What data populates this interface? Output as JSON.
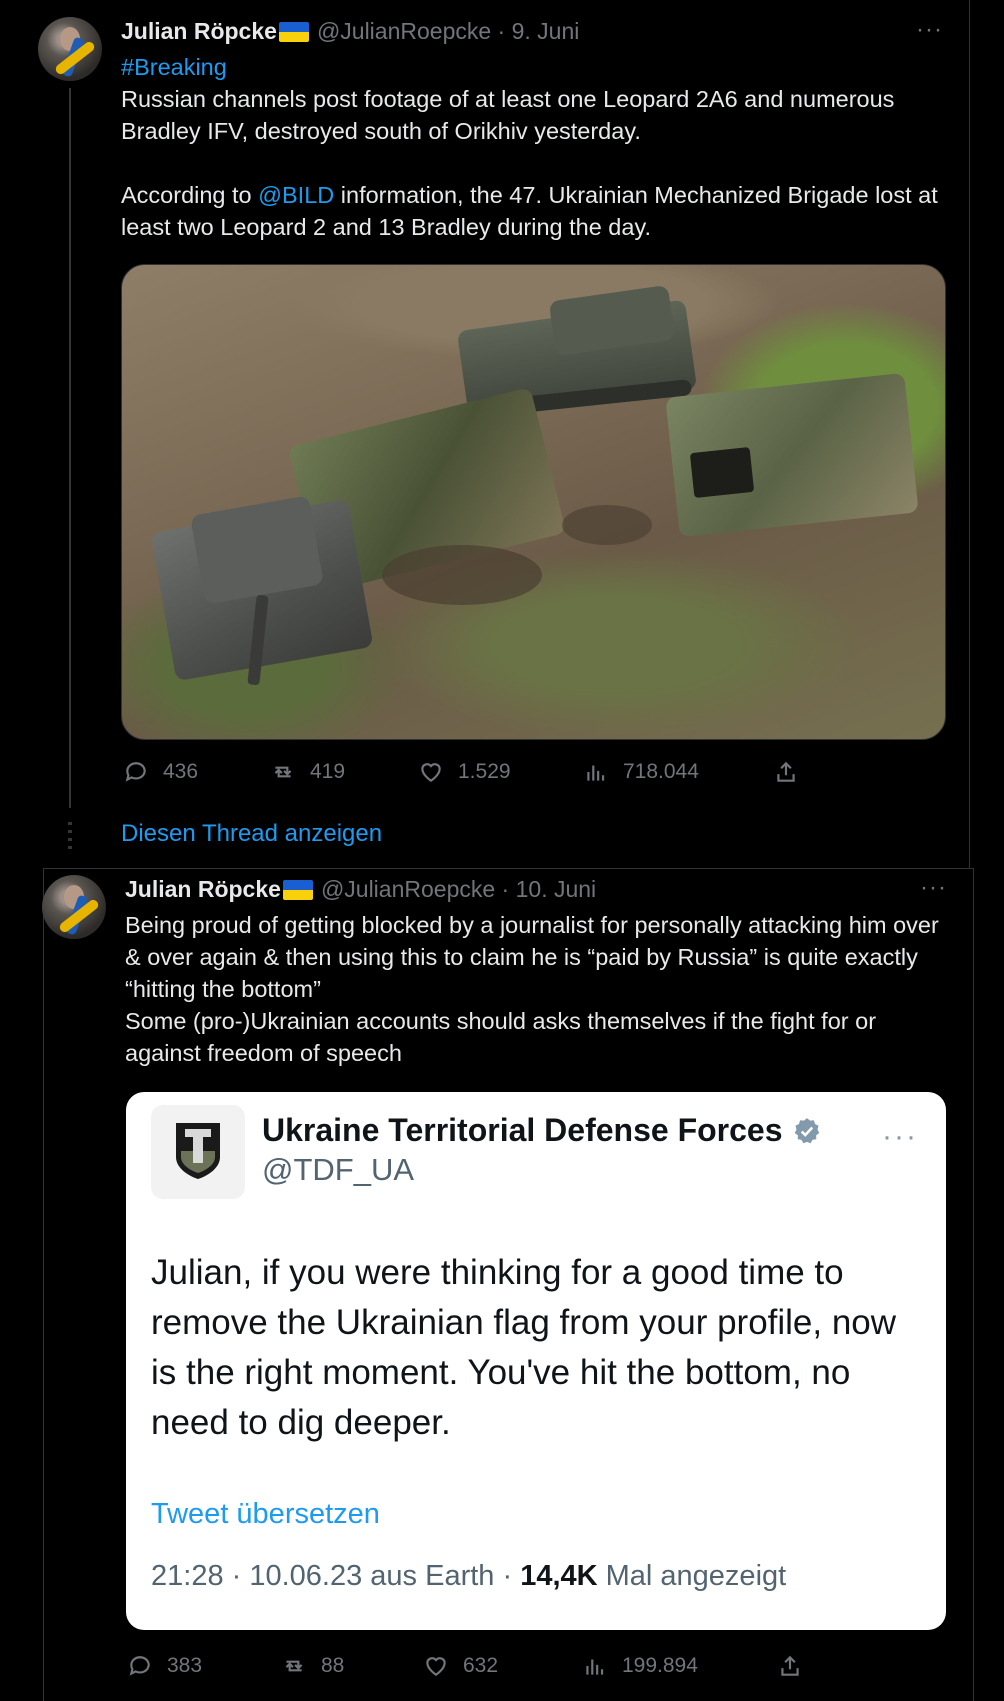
{
  "tweet1": {
    "author_name": "Julian Röpcke",
    "handle": "@JulianRoepcke",
    "date": "9. Juni",
    "more": "···",
    "hashtag": "#Breaking",
    "line1": "Russian channels post footage of at least one Leopard 2A6 and numerous Bradley IFV, destroyed south of Orikhiv yesterday.",
    "line2_prefix": "According to ",
    "mention": "@BILD",
    "line2_suffix": " information, the 47. Ukrainian Mechanized Brigade lost at least two Leopard 2 and 13 Bradley during the day.",
    "replies": "436",
    "retweets": "419",
    "likes": "1.529",
    "views": "718.044"
  },
  "show_thread": "Diesen Thread anzeigen",
  "tweet2": {
    "author_name": "Julian Röpcke",
    "handle": "@JulianRoepcke",
    "date": "10. Juni",
    "more": "···",
    "body_l1": "Being proud of getting blocked by a journalist for personally attacking him over & over again & then using this to claim he is “paid by Russia” is quite exactly “hitting the bottom”",
    "body_l2": "Some (pro-)Ukrainian accounts should asks themselves if the fight for or against freedom of speech",
    "replies": "383",
    "retweets": "88",
    "likes": "632",
    "views": "199.894"
  },
  "quote": {
    "name": "Ukraine Territorial Defense Forces",
    "handle": "@TDF_UA",
    "more": "···",
    "text": "Julian, if you were thinking for a good time to remove the Ukrainian flag from your profile, now is the right moment. You've hit the bottom, no need to dig deeper.",
    "translate": "Tweet übersetzen",
    "meta_prefix": "21:28 · 10.06.23 aus Earth · ",
    "views_bold": "14,4K",
    "views_suffix": " Mal angezeigt"
  },
  "colors": {
    "link": "#1d9bf0",
    "muted": "#71767b",
    "background": "#000000"
  }
}
